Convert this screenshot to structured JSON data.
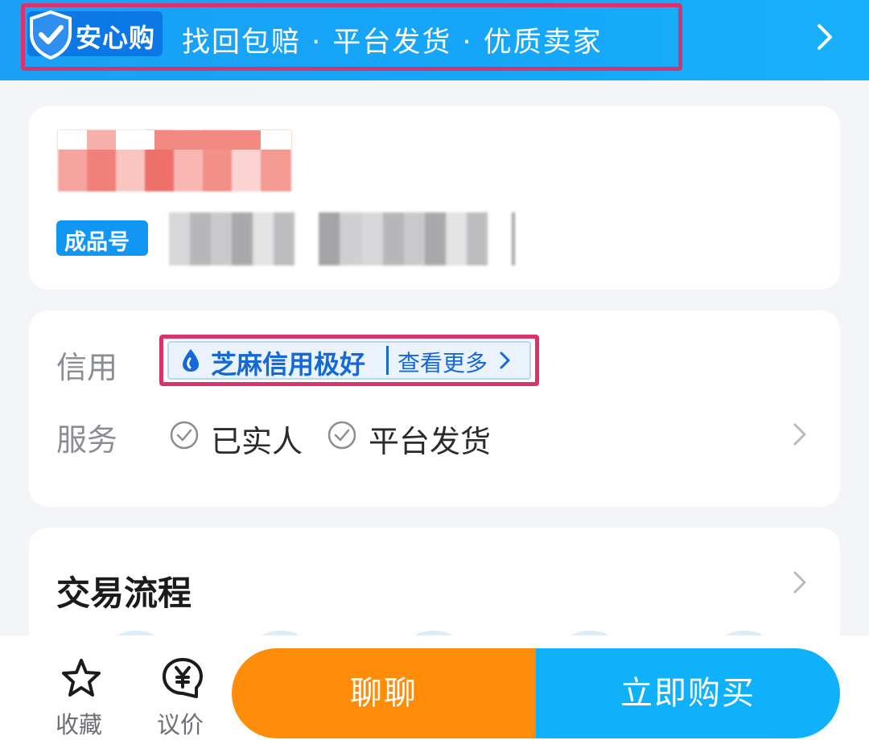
{
  "banner": {
    "brand": "安心购",
    "slogan": "找回包赔 · 平台发货 · 优质卖家",
    "arrow_icon": "chevron-right-icon"
  },
  "product": {
    "tag": "成品号"
  },
  "credit_card": {
    "credit_label": "信用",
    "credit_badge": "芝麻信用极好",
    "credit_more": "查看更多",
    "service_label": "服务",
    "services": [
      {
        "label": "已实人",
        "icon": "check-circle-icon"
      },
      {
        "label": "平台发货",
        "icon": "check-circle-icon"
      }
    ]
  },
  "trade": {
    "title": "交易流程"
  },
  "bottom_bar": {
    "favorite_label": "收藏",
    "bargain_label": "议价",
    "chat_button": "聊聊",
    "buy_button": "立即购买"
  },
  "colors": {
    "banner_blue": "#15a6f8",
    "highlight": "#d6336f",
    "credit_blue": "#1569d6",
    "chat_orange": "#ff8d0a",
    "buy_blue": "#0fb1fa"
  }
}
